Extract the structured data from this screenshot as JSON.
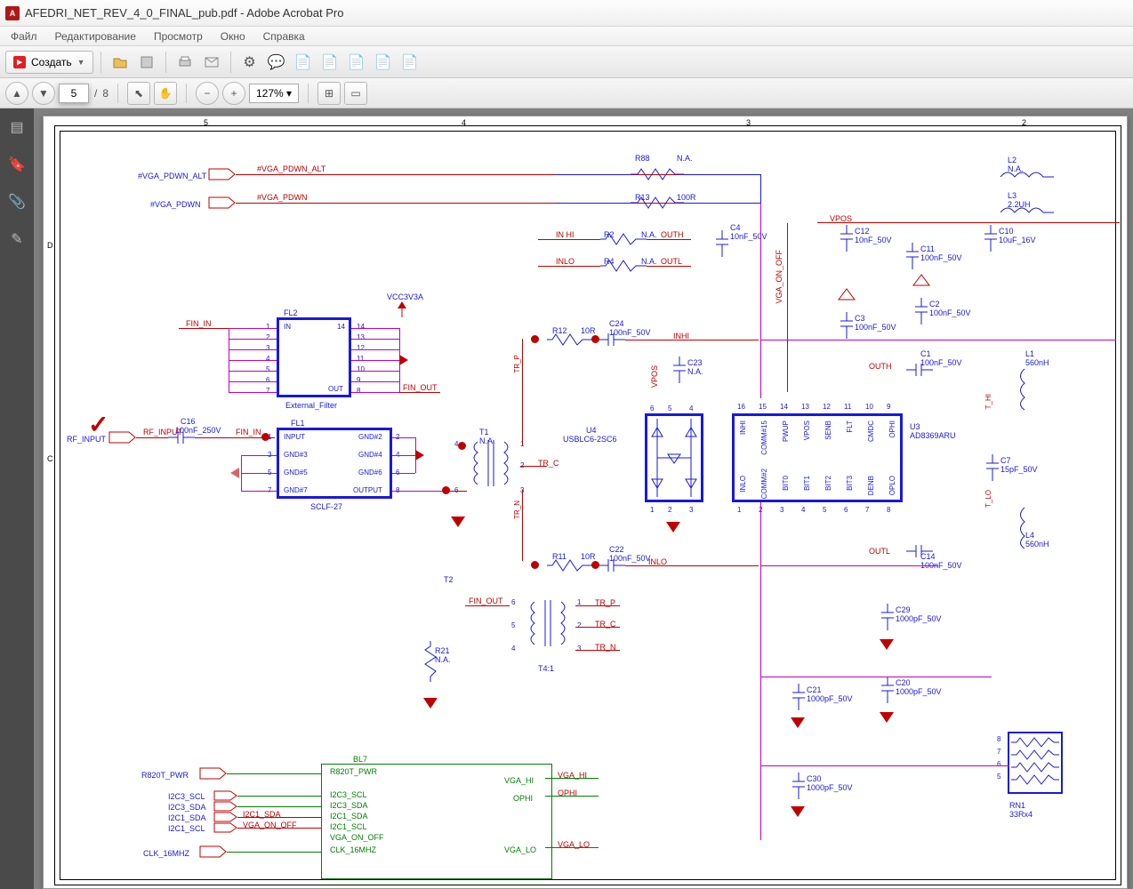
{
  "window": {
    "title": "AFEDRI_NET_REV_4_0_FINAL_pub.pdf - Adobe Acrobat Pro"
  },
  "menu": {
    "file": "Файл",
    "edit": "Редактирование",
    "view": "Просмотр",
    "window": "Окно",
    "help": "Справка"
  },
  "toolbar": {
    "create": "Создать"
  },
  "nav": {
    "page": "5",
    "total": "8",
    "zoom": "127%"
  },
  "ruler": {
    "c5": "5",
    "c4": "4",
    "c3": "3",
    "c2": "2",
    "rD": "D",
    "rC": "C"
  },
  "sig": {
    "vga_pdwn_alt_port": "#VGA_PDWN_ALT",
    "vga_pdwn_alt_net": "#VGA_PDWN_ALT",
    "vga_pdwn_port": "#VGA_PDWN",
    "vga_pdwn_net": "#VGA_PDWN",
    "rf_input": "RF_INPUT",
    "fin_in": "FIN_IN",
    "fin_out": "FIN_OUT",
    "vcc3v3a": "VCC3V3A",
    "in_hi": "IN HI",
    "outh": "OUTH",
    "in_lo": "INLO",
    "outl": "OUTL",
    "inhi2": "INHI",
    "inlo2": "INLO",
    "vpos": "VPOS",
    "vga_on_off": "VGA_ON_OFF",
    "tr_p": "TR_P",
    "tr_c": "TR_C",
    "tr_n": "TR_N",
    "r820t_pwr": "R820T_PWR",
    "i2c3_scl": "I2C3_SCL",
    "i2c3_sda": "I2C3_SDA",
    "i2c1_sda": "I2C1_SDA",
    "i2c1_scl": "I2C1_SCL",
    "clk_16mhz": "CLK_16MHZ",
    "vga_hi": "VGA_HI",
    "ophi": "OPHI",
    "vga_lo": "VGA_LO",
    "t_hi": "T_HI",
    "t_lo": "T_LO"
  },
  "parts": {
    "r88": "R88",
    "r88v": "N.A.",
    "r13": "R13",
    "r13v": "100R",
    "r2": "R2",
    "r2v": "N.A.",
    "r4": "R4",
    "r4v": "N.A.",
    "r12": "R12",
    "r12v": "10R",
    "r11": "R11",
    "r11v": "10R",
    "r21": "R21",
    "r21v": "N.A.",
    "c4": "C4",
    "c4v": "10nF_50V",
    "c12": "C12",
    "c12v": "10nF_50V",
    "c11": "C11",
    "c11v": "100nF_50V",
    "c10": "C10",
    "c10v": "10uF_16V",
    "c3": "C3",
    "c3v": "100nF_50V",
    "c2": "C2",
    "c2v": "100nF_50V",
    "c1": "C1",
    "c1v": "100nF_50V",
    "c7": "C7",
    "c7v": "15pF_50V",
    "c14": "C14",
    "c14v": "100nF_50V",
    "c16": "C16",
    "c16v": "100nF_250V",
    "c24": "C24",
    "c24v": "100nF_50V",
    "c23": "C23",
    "c23v": "N.A.",
    "c22": "C22",
    "c22v": "100nF_50V",
    "c29": "C29",
    "c29v": "1000pF_50V",
    "c21": "C21",
    "c21v": "1000pF_50V",
    "c20": "C20",
    "c20v": "1000pF_50V",
    "c30": "C30",
    "c30v": "1000pF_50V",
    "l1": "L1",
    "l1v": "560nH",
    "l2": "L2",
    "l2v": "N.A.",
    "l3": "L3",
    "l3v": "2.2UH",
    "l4": "L4",
    "l4v": "560nH",
    "rn1": "RN1",
    "rn1v": "33Rx4",
    "fl2": "FL2",
    "fl2name": "External_Filter",
    "fl1": "FL1",
    "fl1name": "SCLF-27",
    "fl1_in": "INPUT",
    "fl1_out": "OUTPUT",
    "fl1_g2": "GND#2",
    "fl1_g3": "GND#3",
    "fl1_g4": "GND#4",
    "fl1_g5": "GND#5",
    "fl1_g6": "GND#6",
    "fl1_g7": "GND#7",
    "fl2_in": "IN",
    "fl2_out": "OUT",
    "t1": "T1",
    "t1v": "N.A.",
    "t2": "T2",
    "t4": "T4:1",
    "u4": "U4",
    "u4name": "USBLC6-2SC6",
    "u3": "U3",
    "u3name": "AD8369ARU",
    "bl7": "BL7",
    "u3_inhi": "INHI",
    "u3_comm15": "COMM#15",
    "u3_pwup": "PWUP",
    "u3_vpos": "VPOS",
    "u3_senb": "SENB",
    "u3_flt": "FLT",
    "u3_cmdc": "CMDC",
    "u3_ophi": "OPHI",
    "u3_inlo": "INLO",
    "u3_comm2": "COMM#2",
    "u3_bit0": "BIT0",
    "u3_bit1": "BIT1",
    "u3_bit2": "BIT2",
    "u3_bit3": "BIT3",
    "u3_denb": "DENB",
    "u3_oplo": "OPLO"
  },
  "pins": {
    "n1": "1",
    "n2": "2",
    "n3": "3",
    "n4": "4",
    "n5": "5",
    "n6": "6",
    "n7": "7",
    "n8": "8",
    "n9": "9",
    "n10": "10",
    "n11": "11",
    "n12": "12",
    "n13": "13",
    "n14": "14",
    "n15": "15",
    "n16": "16"
  }
}
